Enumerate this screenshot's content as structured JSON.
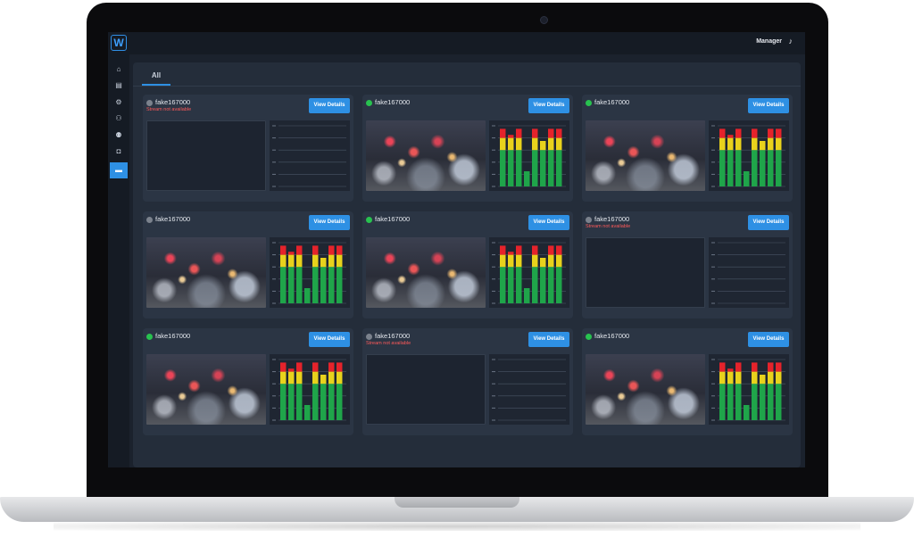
{
  "app": {
    "logo_text": "W",
    "user_label": "Manager",
    "user_icon": "music-note-icon"
  },
  "sidebar": {
    "items": [
      {
        "name": "home",
        "icon": "home-icon",
        "glyph": "⌂"
      },
      {
        "name": "messages",
        "icon": "message-icon",
        "glyph": "▤"
      },
      {
        "name": "settings",
        "icon": "gear-icon",
        "glyph": "⚙"
      },
      {
        "name": "users",
        "icon": "users-icon",
        "glyph": "⚇"
      },
      {
        "name": "groups",
        "icon": "group-icon",
        "glyph": "⚉"
      },
      {
        "name": "devices",
        "icon": "device-icon",
        "glyph": "◘"
      },
      {
        "name": "streams",
        "icon": "streams-icon",
        "glyph": "▬",
        "active": true
      }
    ]
  },
  "tabs": [
    {
      "label": "All"
    }
  ],
  "colors": {
    "accent": "#2e90e4",
    "online": "#28c24f",
    "offline": "#7b828d",
    "error_text": "#ff5a5a",
    "bar_green": "#1fa54a",
    "bar_yellow": "#e8d21c",
    "bar_red": "#e5232b"
  },
  "cards": [
    {
      "name": "fake167000",
      "status": "offline",
      "status_text": "Stream not available",
      "button": "View Details"
    },
    {
      "name": "fake167000",
      "status": "online",
      "status_text": "",
      "button": "View Details"
    },
    {
      "name": "fake167000",
      "status": "online",
      "status_text": "",
      "button": "View Details"
    },
    {
      "name": "fake167000",
      "status": "offline",
      "status_text": "",
      "button": "View Details"
    },
    {
      "name": "fake167000",
      "status": "online",
      "status_text": "",
      "button": "View Details"
    },
    {
      "name": "fake167000",
      "status": "offline",
      "status_text": "Stream not available",
      "button": "View Details"
    },
    {
      "name": "fake167000",
      "status": "online",
      "status_text": "",
      "button": "View Details"
    },
    {
      "name": "fake167000",
      "status": "offline",
      "status_text": "Stream not available",
      "button": "View Details"
    },
    {
      "name": "fake167000",
      "status": "online",
      "status_text": "",
      "button": "View Details"
    }
  ],
  "chart_data": {
    "type": "bar",
    "ylim": [
      0,
      1
    ],
    "levels": [
      0.95,
      0.85,
      0.95,
      0.25,
      0.95,
      0.75,
      0.95,
      0.95
    ],
    "green_max": 0.6,
    "yellow_max": 0.8
  }
}
